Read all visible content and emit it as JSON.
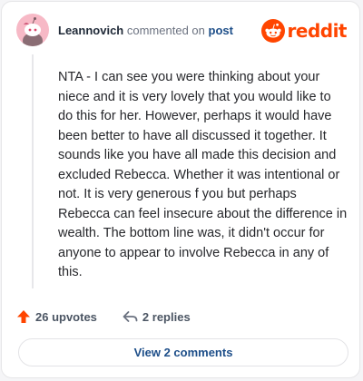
{
  "header": {
    "author": "Leannovich",
    "action_text": "commented on",
    "post_link": "post",
    "brand_word": "reddit",
    "avatar_icon": "snoo-avatar-icon",
    "brand_icon": "reddit-logo-icon"
  },
  "comment": {
    "body": "NTA - I can see you were thinking about your niece and it is very lovely that you would like to do this for her. However, perhaps it would have been better to have all discussed it together. It sounds like you have all made this decision and excluded Rebecca. Whether it was intentional or not. It is very generous f you but perhaps Rebecca can feel insecure about the difference in wealth. The bottom line was, it didn't occur for anyone to appear to involve Rebecca in any of this."
  },
  "actions": {
    "upvotes_label": "26 upvotes",
    "replies_label": "2 replies",
    "upvote_icon": "upvote-arrow-icon",
    "reply_icon": "reply-arrow-icon"
  },
  "footer": {
    "view_comments_label": "View 2 comments"
  },
  "colors": {
    "brand": "#ff4500",
    "link": "#1d4e89",
    "avatar_bg": "#f7b9c6"
  }
}
